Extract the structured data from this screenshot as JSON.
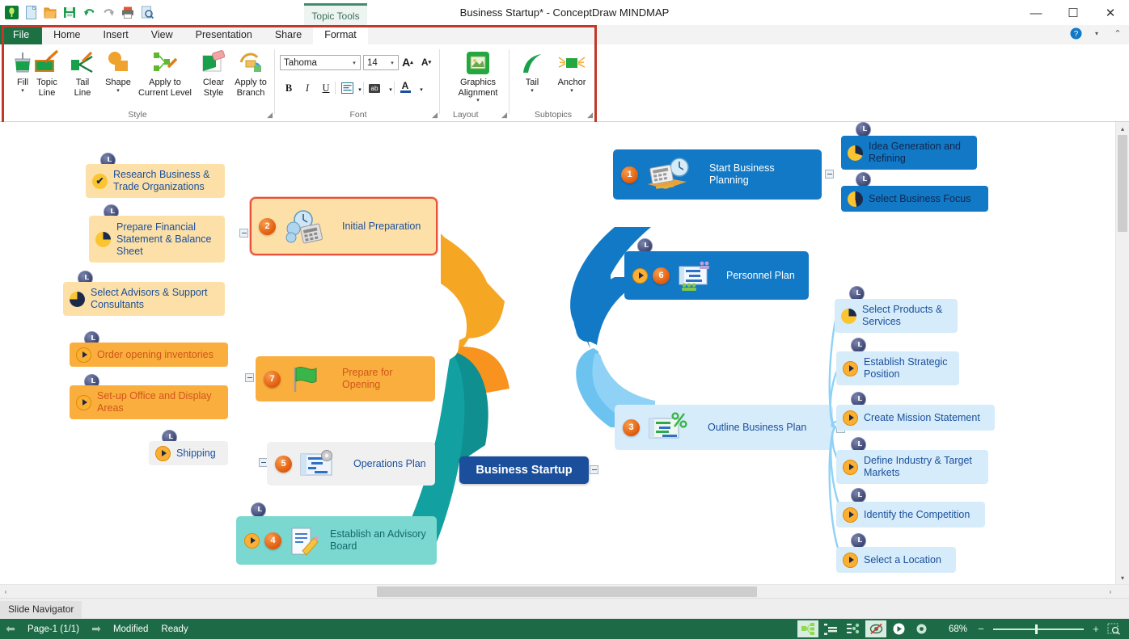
{
  "window": {
    "title": "Business Startup* - ConceptDraw MINDMAP",
    "minimize": "—",
    "maximize": "☐",
    "close": "✕"
  },
  "quick_access": [
    {
      "name": "app-logo-icon",
      "glyph": "◉"
    },
    {
      "name": "new-document-icon",
      "glyph": "□"
    },
    {
      "name": "open-folder-icon",
      "glyph": "▰"
    },
    {
      "name": "save-icon",
      "glyph": "▣"
    },
    {
      "name": "undo-icon",
      "glyph": "↶"
    },
    {
      "name": "redo-icon",
      "glyph": "↷"
    },
    {
      "name": "print-icon",
      "glyph": "⎙"
    },
    {
      "name": "print-preview-icon",
      "glyph": "⌕"
    }
  ],
  "context_tab": "Topic Tools",
  "tabs": [
    {
      "label": "File",
      "kind": "file"
    },
    {
      "label": "Home",
      "kind": "normal"
    },
    {
      "label": "Insert",
      "kind": "normal"
    },
    {
      "label": "View",
      "kind": "normal"
    },
    {
      "label": "Presentation",
      "kind": "normal"
    },
    {
      "label": "Share",
      "kind": "normal"
    },
    {
      "label": "Format",
      "kind": "active"
    }
  ],
  "help": {
    "help_glyph": "?",
    "dropdown_glyph": "▾",
    "collapse_glyph": "⌃"
  },
  "ribbon": {
    "style_group": {
      "label": "Style",
      "buttons": [
        {
          "label": "Fill",
          "has_caret": true,
          "icon": "paint-bucket-icon"
        },
        {
          "label": "Topic\nLine",
          "has_caret": true,
          "inline_caret": true,
          "icon": "topic-line-icon"
        },
        {
          "label": "Tail\nLine",
          "has_caret": true,
          "inline_caret": true,
          "icon": "tail-line-icon"
        },
        {
          "label": "Shape",
          "has_caret": true,
          "icon": "shape-icon"
        },
        {
          "label": "Apply to\nCurrent Level",
          "has_caret": false,
          "icon": "apply-current-level-icon"
        },
        {
          "label": "Clear\nStyle",
          "has_caret": false,
          "icon": "clear-style-icon"
        },
        {
          "label": "Apply to\nBranch",
          "has_caret": false,
          "icon": "apply-branch-icon"
        }
      ]
    },
    "font_group": {
      "label": "Font",
      "font_family": "Tahoma",
      "font_size": "14",
      "grow_font": "A",
      "shrink_font": "A",
      "bold": "B",
      "italic": "I",
      "underline": "U",
      "align": "☰",
      "highlight": "ab",
      "font_color": "A"
    },
    "layout_group": {
      "label": "Layout",
      "graphics_alignment": "Graphics\nAlignment"
    },
    "subtopics_group": {
      "label": "Subtopics",
      "buttons": [
        {
          "label": "Tail",
          "icon": "tail-curve-icon"
        },
        {
          "label": "Anchor",
          "icon": "anchor-icon"
        }
      ]
    },
    "dialog_launcher_glyph": "◢"
  },
  "mindmap": {
    "center": {
      "label": "Business Startup"
    },
    "topics": [
      {
        "id": "initial-preparation",
        "label": "Initial Preparation",
        "badge": "2",
        "icon": "clock-calculator-icon",
        "selected": true,
        "subtopics": [
          {
            "label": "Research Business & Trade Organizations",
            "marker": "check"
          },
          {
            "label": "Prepare Financial Statement & Balance Sheet",
            "marker": "pie75"
          },
          {
            "label": "Select Advisors & Support Consultants",
            "marker": "pie75"
          }
        ]
      },
      {
        "id": "prepare-for-opening",
        "label": "Prepare for Opening",
        "badge": "7",
        "icon": "green-flag-icon",
        "selected": false,
        "subtopics": [
          {
            "label": "Order opening inventories",
            "marker": "play"
          },
          {
            "label": "Set-up Office and Display Areas",
            "marker": "play"
          }
        ]
      },
      {
        "id": "operations-plan",
        "label": "Operations Plan",
        "badge": "5",
        "icon": "gantt-gear-icon",
        "selected": false,
        "subtopics": [
          {
            "label": "Shipping",
            "marker": "play"
          }
        ]
      },
      {
        "id": "establish-advisory-board",
        "label": "Establish an Advisory Board",
        "badge": "4",
        "icon": "note-pencil-icon",
        "selected": false,
        "subtopics": []
      },
      {
        "id": "start-business-planning",
        "label": "Start Business Planning",
        "badge": "1",
        "icon": "calculator-clock-icon",
        "selected": false,
        "subtopics": [
          {
            "label": "Idea Generation and Refining",
            "marker": "pie70"
          },
          {
            "label": "Select Business Focus",
            "marker": "pie60"
          }
        ]
      },
      {
        "id": "personnel-plan",
        "label": "Personnel Plan",
        "badge": "6",
        "icon": "people-chart-icon",
        "selected": false,
        "subtopics": []
      },
      {
        "id": "outline-business-plan",
        "label": "Outline Business Plan",
        "badge": "3",
        "icon": "percent-chart-icon",
        "selected": false,
        "subtopics": [
          {
            "label": "Select Products & Services",
            "marker": "pie75"
          },
          {
            "label": "Establish Strategic Position",
            "marker": "play"
          },
          {
            "label": "Create Mission Statement",
            "marker": "play"
          },
          {
            "label": "Define Industry & Target Markets",
            "marker": "play"
          },
          {
            "label": "Identify the Competition",
            "marker": "play"
          },
          {
            "label": "Select a Location",
            "marker": "play"
          }
        ]
      }
    ]
  },
  "panel": {
    "slide_navigator": "Slide Navigator",
    "collapse_glyph": "‹"
  },
  "status": {
    "prev_glyph": "⬅",
    "page": "Page-1 (1/1)",
    "next_glyph": "➡",
    "modified": "Modified",
    "ready": "Ready",
    "zoom": "68%",
    "zoom_out": "−",
    "zoom_in": "+",
    "view_buttons": [
      {
        "name": "mindmap-view-icon",
        "active": true
      },
      {
        "name": "outline-view-icon",
        "active": false
      },
      {
        "name": "tree-view-icon",
        "active": false
      },
      {
        "name": "hide-branch-icon",
        "active": true
      },
      {
        "name": "play-presentation-icon",
        "active": false
      },
      {
        "name": "gear-view-icon",
        "active": false
      }
    ],
    "fit-page-icon": "⬚"
  },
  "scroll": {
    "left_glyph": "‹",
    "right_glyph": "›",
    "up_glyph": "▴",
    "down_glyph": "▾"
  },
  "colors": {
    "accent_green": "#1d7044",
    "center_blue": "#1b4f9c",
    "orange": "#f5a623",
    "deep_orange": "#f79000",
    "teal": "#0f9a9a",
    "blue": "#1279c6",
    "light_blue": "#d6ecfa",
    "selection_red": "#e8503a"
  }
}
